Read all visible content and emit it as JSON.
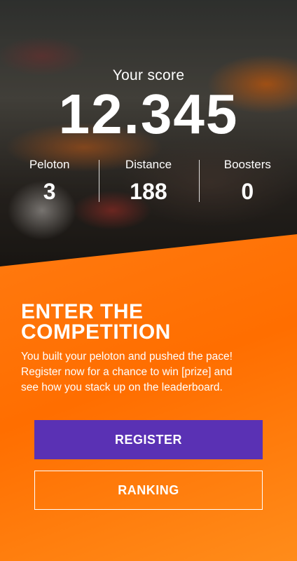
{
  "score": {
    "label": "Your score",
    "value": "12.345"
  },
  "stats": [
    {
      "name": "Peloton",
      "value": "3"
    },
    {
      "name": "Distance",
      "value": "188"
    },
    {
      "name": "Boosters",
      "value": "0"
    }
  ],
  "competition": {
    "title_line1": "ENTER THE",
    "title_line2": "COMPETITION",
    "line1": "You built your peloton and pushed the pace!",
    "line2": "Register now for a chance to win [prize] and",
    "line3": "see how you stack up on the leaderboard."
  },
  "buttons": {
    "register": "REGISTER",
    "ranking": "RANKING"
  },
  "colors": {
    "accent_orange": "#ff7a10",
    "register_purple": "#5a31b4",
    "text": "#ffffff"
  }
}
